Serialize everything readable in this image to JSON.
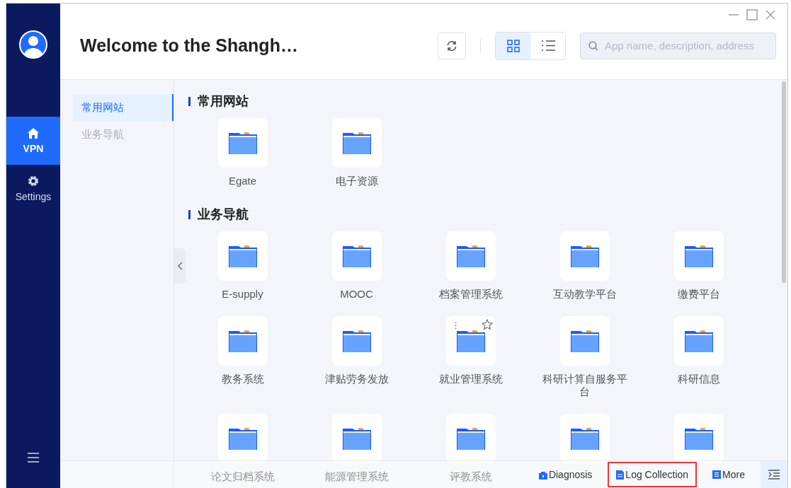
{
  "window": {
    "title": "Welcome to the Shangh…"
  },
  "rail": {
    "items": [
      {
        "label": "VPN",
        "kind": "home",
        "selected": true
      },
      {
        "label": "Settings",
        "kind": "gear",
        "selected": false
      }
    ]
  },
  "toolbar": {
    "views": [
      {
        "kind": "grid",
        "selected": true
      },
      {
        "kind": "list",
        "selected": false
      }
    ],
    "search": {
      "placeholder": "App name, description, address"
    }
  },
  "categories": [
    {
      "label": "常用网站",
      "selected": true
    },
    {
      "label": "业务导航",
      "selected": false
    }
  ],
  "sections": [
    {
      "title": "常用网站",
      "apps": [
        {
          "label": "Egate",
          "hovered": false
        },
        {
          "label": "电子资源",
          "hovered": false
        }
      ]
    },
    {
      "title": "业务导航",
      "apps": [
        {
          "label": "E-supply",
          "hovered": false
        },
        {
          "label": "MOOC",
          "hovered": false
        },
        {
          "label": "档案管理系统",
          "hovered": false
        },
        {
          "label": "互动教学平台",
          "hovered": false
        },
        {
          "label": "缴费平台",
          "hovered": false
        },
        {
          "label": "教务系统",
          "hovered": false
        },
        {
          "label": "津贴劳务发放",
          "hovered": false
        },
        {
          "label": "就业管理系统",
          "hovered": true
        },
        {
          "label": "科研计算自服务平台",
          "hovered": false
        },
        {
          "label": "科研信息",
          "hovered": false
        },
        {
          "label": "论文归档系统",
          "hovered": false
        },
        {
          "label": "能源管理系统",
          "hovered": false
        },
        {
          "label": "评教系统",
          "hovered": false
        },
        {
          "hovered": false
        },
        {
          "hovered": false
        }
      ]
    }
  ],
  "footer": {
    "links": [
      {
        "label": "Diagnosis",
        "kind": "diagnosis",
        "highlighted": false
      },
      {
        "label": "Log Collection",
        "kind": "log",
        "highlighted": true
      },
      {
        "label": "More",
        "kind": "more",
        "highlighted": false
      }
    ]
  }
}
